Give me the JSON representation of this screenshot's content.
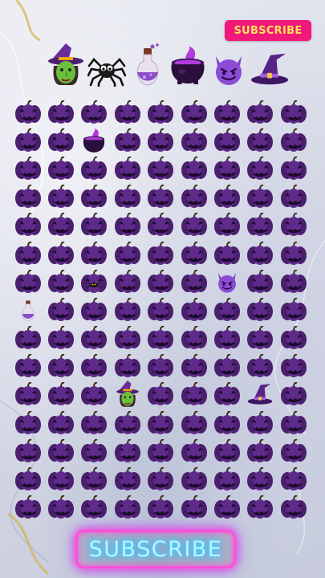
{
  "header": {
    "subscribe_badge": "SUBSCRIBE"
  },
  "legend": [
    {
      "icon": "witch-icon"
    },
    {
      "icon": "spider-icon"
    },
    {
      "icon": "potion-icon"
    },
    {
      "icon": "cauldron-icon"
    },
    {
      "icon": "devil-face-icon"
    },
    {
      "icon": "witch-hat-icon"
    }
  ],
  "grid": {
    "rows": 15,
    "cols": 9,
    "default_icon": "pumpkin-icon",
    "hidden_items": [
      {
        "row": 2,
        "col": 3,
        "icon": "cauldron-icon"
      },
      {
        "row": 7,
        "col": 3,
        "icon": "spider-icon"
      },
      {
        "row": 7,
        "col": 7,
        "icon": "devil-face-icon"
      },
      {
        "row": 8,
        "col": 1,
        "icon": "potion-icon"
      },
      {
        "row": 11,
        "col": 4,
        "icon": "witch-icon"
      },
      {
        "row": 11,
        "col": 8,
        "icon": "witch-hat-icon"
      }
    ]
  },
  "footer": {
    "subscribe_button": "SUBSCRIBE"
  },
  "colors": {
    "pumpkin": "#5b2a86",
    "badge_bg": "#f0187a",
    "badge_text": "#ffe25a",
    "neon_border": "#ff4fd8",
    "neon_text": "#b8f4ff"
  }
}
